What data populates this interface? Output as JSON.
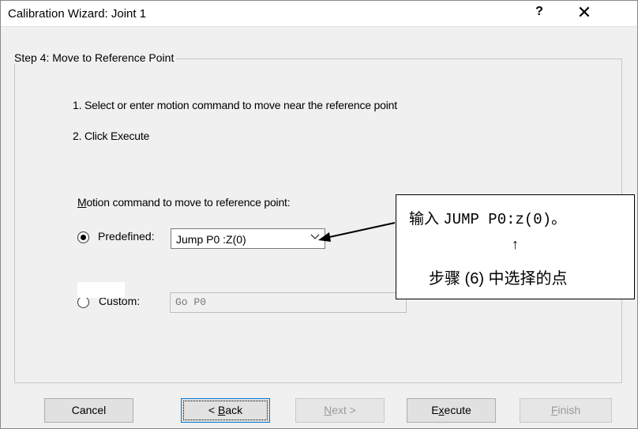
{
  "window": {
    "title": "Calibration Wizard: Joint 1",
    "help_glyph": "?",
    "close_glyph": "✕"
  },
  "step": {
    "legend": "Step 4: Move to Reference Point",
    "instructions": [
      "1. Select or enter motion command to move near the reference point",
      "2. Click Execute"
    ]
  },
  "motion": {
    "label_prefix": "M",
    "label_rest": "otion command to move to reference point:",
    "predefined_label": "Predefined:",
    "predefined_selected": true,
    "predefined_value": "Jump P0 :Z(0)",
    "custom_label": "Custom:",
    "custom_selected": false,
    "custom_value": "Go P0"
  },
  "callout": {
    "prefix": "输入 ",
    "command": "JUMP P0:z(0)",
    "suffix": "。",
    "arrow": "↑",
    "note": "步骤 (6) 中选择的点"
  },
  "buttons": {
    "cancel": "Cancel",
    "back_prefix": "< ",
    "back_hotkey": "B",
    "back_rest": "ack",
    "next_prefix": "N",
    "next_rest": "ext >",
    "execute_prefix": "E",
    "execute_hotkey": "x",
    "execute_rest": "ecute",
    "finish_hotkey": "F",
    "finish_rest": "inish"
  },
  "icons": {
    "dropdown": "chevron-down-icon",
    "pointer": "arrow-icon"
  }
}
